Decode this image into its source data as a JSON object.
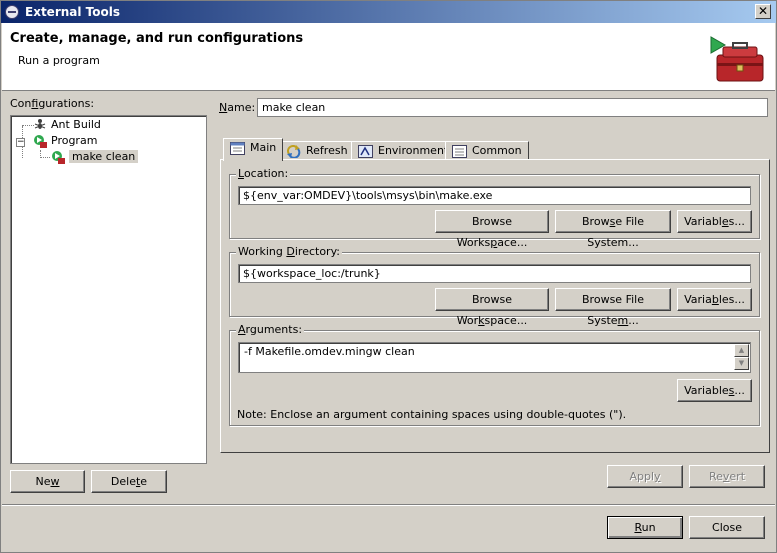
{
  "window": {
    "title": "External Tools",
    "close_label": "✕"
  },
  "header": {
    "title": "Create, manage, and run configurations",
    "subtitle": "Run a program"
  },
  "configurations": {
    "label_pre": "Con",
    "label_u": "f",
    "label_post": "igurations:",
    "items": [
      {
        "label": "Ant Build",
        "icon": "ant-icon"
      },
      {
        "label": "Program",
        "icon": "program-icon",
        "expander": "−"
      },
      {
        "label": "make clean",
        "icon": "program-config-icon"
      }
    ],
    "new_pre": "Ne",
    "new_u": "w",
    "new_post": "",
    "delete_pre": "Dele",
    "delete_u": "t",
    "delete_post": "e"
  },
  "name": {
    "label_u": "N",
    "label_post": "ame:",
    "value": "make clean"
  },
  "tabs": [
    {
      "label": "Main",
      "icon": "main-tab-icon"
    },
    {
      "label": "Refresh",
      "icon": "refresh-icon"
    },
    {
      "label": "Environment",
      "icon": "environment-icon"
    },
    {
      "label": "Common",
      "icon": "common-icon"
    }
  ],
  "location": {
    "label_pre": "",
    "label_u": "L",
    "label_post": "ocation:",
    "value": "${env_var:OMDEV}\\tools\\msys\\bin\\make.exe",
    "browse_ws_pre": "Browse Works",
    "browse_ws_u": "p",
    "browse_ws_post": "ace...",
    "browse_fs_pre": "Brow",
    "browse_fs_u": "s",
    "browse_fs_post": "e File System...",
    "vars_pre": "Variabl",
    "vars_u": "e",
    "vars_post": "s..."
  },
  "working_dir": {
    "label_pre": "Working ",
    "label_u": "D",
    "label_post": "irectory:",
    "value": "${workspace_loc:/trunk}",
    "browse_ws_pre": "Browse Wor",
    "browse_ws_u": "k",
    "browse_ws_post": "space...",
    "browse_fs_pre": "Browse File Syste",
    "browse_fs_u": "m",
    "browse_fs_post": "...",
    "vars_pre": "Varia",
    "vars_u": "b",
    "vars_post": "les..."
  },
  "arguments": {
    "label_pre": "",
    "label_u": "A",
    "label_post": "rguments:",
    "value": "-f Makefile.omdev.mingw clean",
    "vars_pre": "Variable",
    "vars_u": "s",
    "vars_post": "...",
    "note": "Note: Enclose an argument containing spaces using double-quotes (\")."
  },
  "footer": {
    "apply_pre": "Appl",
    "apply_u": "y",
    "apply_post": "",
    "revert_pre": "Re",
    "revert_u": "v",
    "revert_post": "ert",
    "run_pre": "",
    "run_u": "R",
    "run_post": "un",
    "close_label": "Close"
  }
}
